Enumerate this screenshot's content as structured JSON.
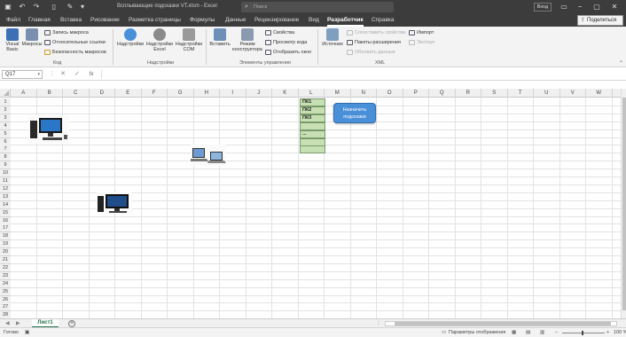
{
  "titlebar": {
    "title": "Всплывающие подсказки VT.xlsm - Excel",
    "search_placeholder": "Поиск",
    "login": "Вход",
    "icons": [
      "save-icon",
      "undo-icon",
      "redo-icon",
      "search-icon"
    ]
  },
  "tabs": [
    {
      "label": "Файл"
    },
    {
      "label": "Главная"
    },
    {
      "label": "Вставка"
    },
    {
      "label": "Рисование"
    },
    {
      "label": "Разметка страницы"
    },
    {
      "label": "Формулы"
    },
    {
      "label": "Данные"
    },
    {
      "label": "Рецензирование"
    },
    {
      "label": "Вид"
    },
    {
      "label": "Разработчик",
      "active": true
    },
    {
      "label": "Справка"
    }
  ],
  "share_label": "Поделиться",
  "ribbon": {
    "code": {
      "group_label": "Код",
      "visual_basic": "Visual Basic",
      "macros": "Макросы",
      "record_macro": "Запись макроса",
      "relative_refs": "Относительные ссылки",
      "macro_security": "Безопасность макросов"
    },
    "addins": {
      "group_label": "Надстройки",
      "addins": "Надстройки",
      "excel_addins": "Надстройки Excel",
      "com_addins": "Надстройки COM"
    },
    "controls": {
      "group_label": "Элементы управления",
      "insert": "Вставить",
      "design_mode": "Режим конструктора",
      "properties": "Свойства",
      "view_code": "Просмотр кода",
      "run_dialog": "Отобразить окно"
    },
    "xml": {
      "group_label": "XML",
      "source": "Источник",
      "map_properties": "Сопоставить свойства",
      "expansion_packs": "Пакеты расширения",
      "refresh_data": "Обновить данные",
      "import": "Импорт",
      "export": "Экспорт"
    }
  },
  "formulabar": {
    "namebox": "Q17",
    "cancel": "✕",
    "enter": "✓",
    "fx": "fx"
  },
  "columns": [
    "A",
    "B",
    "C",
    "D",
    "E",
    "F",
    "G",
    "H",
    "I",
    "J",
    "K",
    "L",
    "M",
    "N",
    "O",
    "P",
    "Q",
    "R",
    "S",
    "T",
    "U",
    "V",
    "W"
  ],
  "rows": [
    "1",
    "2",
    "3",
    "4",
    "5",
    "6",
    "7",
    "8",
    "9",
    "10",
    "11",
    "12",
    "13",
    "14",
    "15",
    "16",
    "17",
    "18",
    "19",
    "20",
    "21",
    "22",
    "23",
    "24",
    "25",
    "26",
    "27",
    "28"
  ],
  "cells_L": [
    "ПК1",
    "ПК2",
    "ПК3",
    "",
    "...",
    "",
    ""
  ],
  "hint_button": "Назначить подсказки",
  "sheet_tab": "Лист1",
  "status": {
    "ready": "Готово",
    "display_settings": "Параметры отображения",
    "zoom": "100 %"
  },
  "colors": {
    "accent": "#217346",
    "hint_button": "#4a90d9",
    "cell_green": "#c6e0b4"
  }
}
